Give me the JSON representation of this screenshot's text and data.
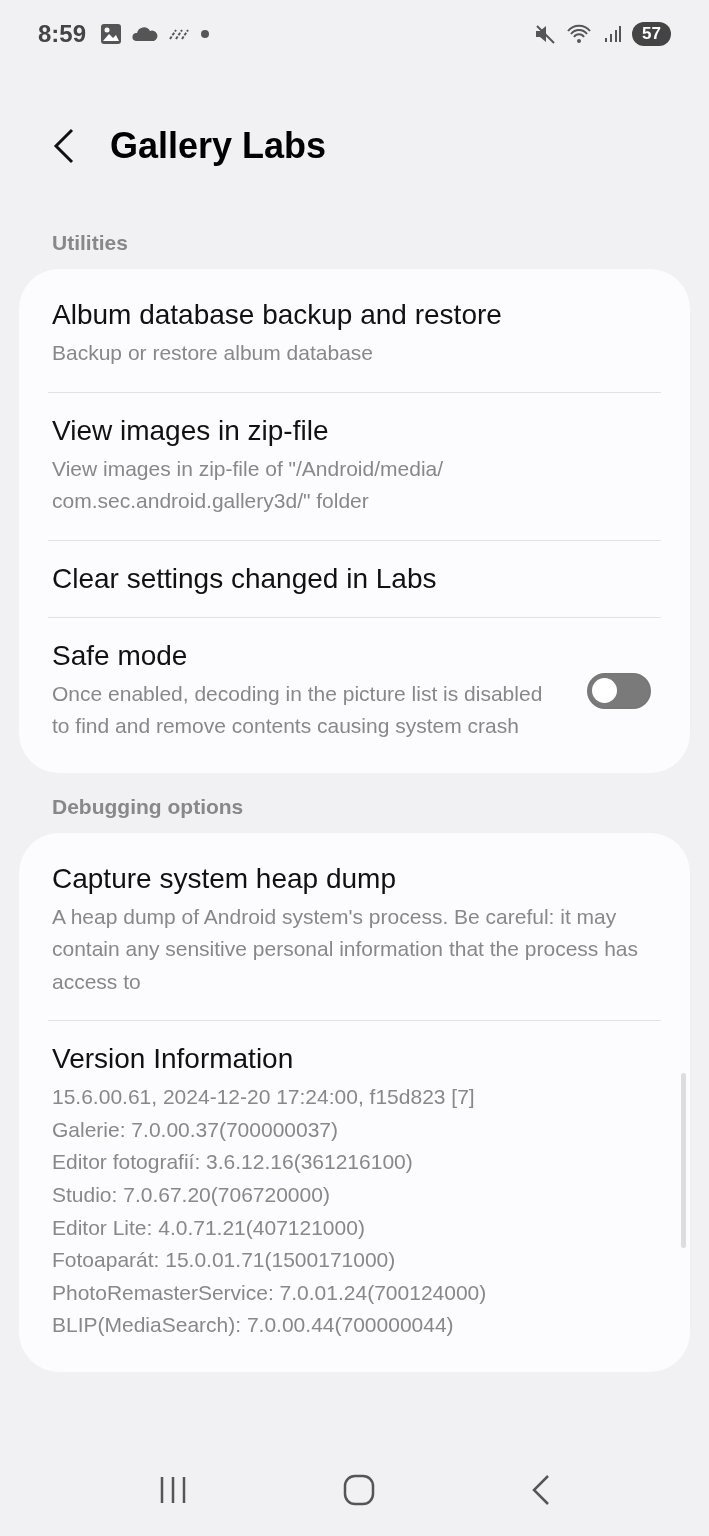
{
  "status_bar": {
    "time": "8:59",
    "battery": "57"
  },
  "header": {
    "title": "Gallery Labs"
  },
  "sections": [
    {
      "title": "Utilities",
      "items": [
        {
          "kind": "link",
          "title": "Album database backup and restore",
          "subtitle": "Backup or restore album database"
        },
        {
          "kind": "link",
          "title": "View images in zip-file",
          "subtitle": "View images in zip-file of \"/Android/media/ com.sec.android.gallery3d/\" folder"
        },
        {
          "kind": "link",
          "title": "Clear settings changed in Labs"
        },
        {
          "kind": "toggle",
          "title": "Safe mode",
          "subtitle": "Once enabled, decoding in the picture list is disabled to find and remove contents causing system crash",
          "on": false
        }
      ]
    },
    {
      "title": "Debugging options",
      "items": [
        {
          "kind": "link",
          "title": "Capture system heap dump",
          "subtitle": "A heap dump of Android system's process. Be careful: it may contain any sensitive personal information that the process has access to"
        },
        {
          "kind": "info",
          "title": "Version Information",
          "lines": [
            "15.6.00.61, 2024-12-20 17:24:00, f15d823 [7]",
            "Galerie: 7.0.00.37(700000037)",
            "Editor fotografií: 3.6.12.16(361216100)",
            "Studio: 7.0.67.20(706720000)",
            "Editor Lite: 4.0.71.21(407121000)",
            "Fotoaparát: 15.0.01.71(1500171000)",
            "PhotoRemasterService: 7.0.01.24(700124000)",
            "BLIP(MediaSearch): 7.0.00.44(700000044)"
          ]
        }
      ]
    }
  ]
}
